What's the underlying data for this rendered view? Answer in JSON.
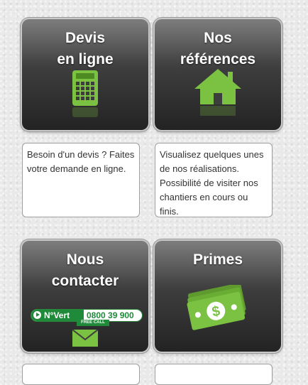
{
  "tiles": [
    {
      "line1": "Devis",
      "line2": "en ligne",
      "desc": "Besoin d'un devis ? Faites votre demande en ligne.",
      "icon": "calculator-icon"
    },
    {
      "line1": "Nos",
      "line2": "références",
      "desc": "Visualisez quelques unes de nos réalisations. Possibilité de visiter nos chantiers en cours ou finis.",
      "icon": "house-icon"
    },
    {
      "line1": "Nous",
      "line2": "contacter",
      "icon": "envelope-icon"
    },
    {
      "line1": "Primes",
      "icon": "money-icon"
    }
  ],
  "contact_badge": {
    "label": "N°Vert",
    "number": "0800 39 900",
    "sub": "FREE CALL"
  },
  "colors": {
    "accent_green": "#7cc242",
    "badge_green": "#1f8a3a",
    "tile_dark": "#2a2a2a"
  }
}
